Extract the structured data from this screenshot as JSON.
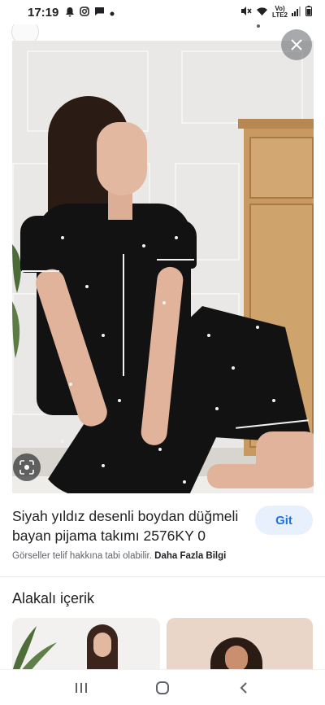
{
  "status_bar": {
    "time": "17:19",
    "icons_left": [
      "notification-icon",
      "instagram-icon",
      "message-icon",
      "dot-icon"
    ],
    "icons_right": [
      "mute-icon",
      "wifi-icon",
      "volte-icon",
      "signal-icon",
      "battery-icon"
    ],
    "volte_line1": "Vo)",
    "volte_line2": "LTE2"
  },
  "viewer": {
    "close_icon": "close-icon",
    "lens_icon": "google-lens-icon"
  },
  "result": {
    "title": "Siyah yıldız desenli boydan düğmeli bayan pijama takımı 2576KY 0",
    "visit_button": "Git",
    "copyright_notice": "Görseller telif hakkına tabi olabilir.",
    "more_info_link": "Daha Fazla Bilgi"
  },
  "related": {
    "heading": "Alakalı içerik"
  },
  "nav_bar": {
    "icons": [
      "recent-apps-icon",
      "home-icon",
      "back-icon"
    ]
  },
  "colors": {
    "accent": "#1a73e8",
    "accent_bg": "#e8f0fe",
    "text_primary": "#202124",
    "text_secondary": "#5f6368"
  }
}
